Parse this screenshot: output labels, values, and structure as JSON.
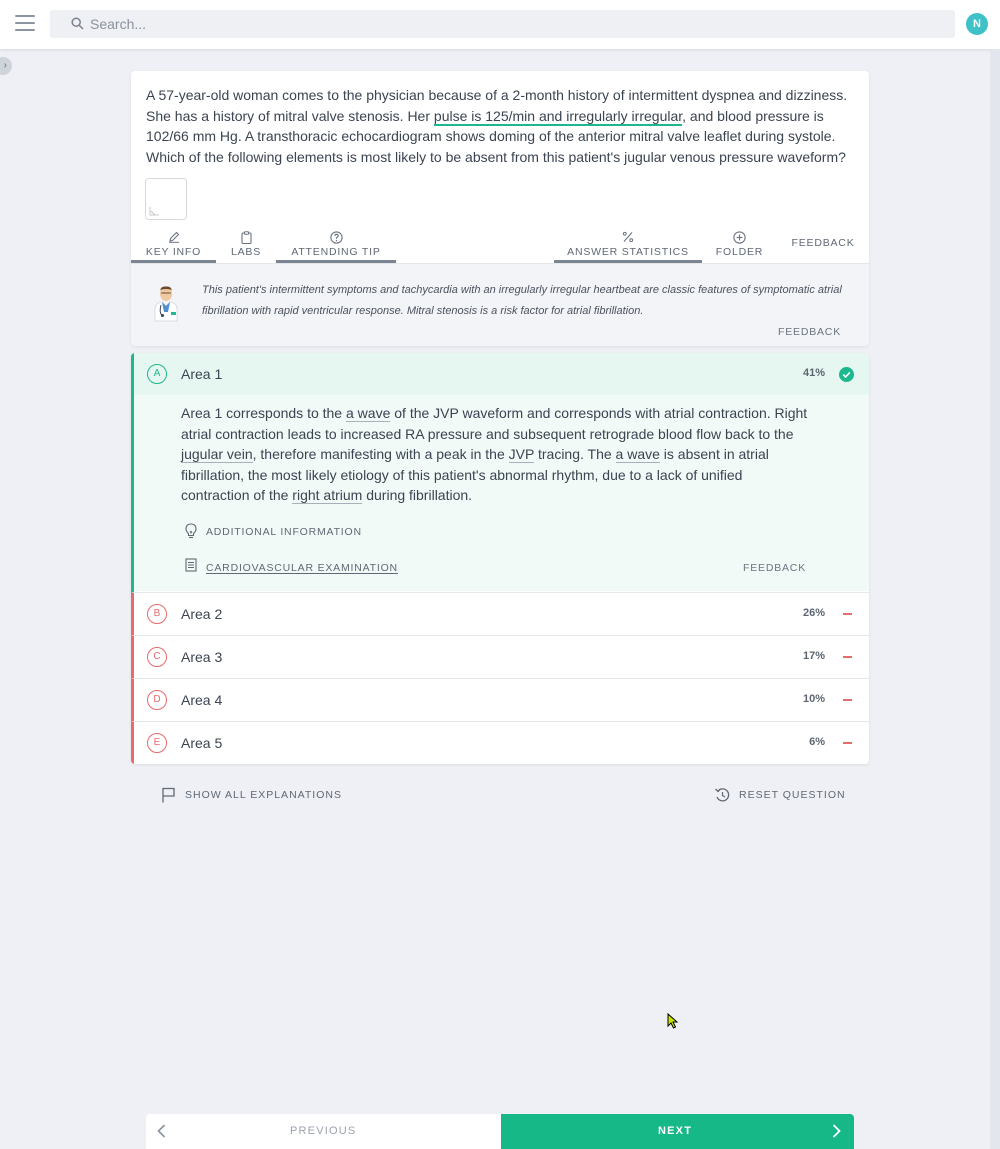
{
  "header": {
    "search_placeholder": "Search...",
    "avatar_initial": "N"
  },
  "question": {
    "stem_part1": "A 57-year-old woman comes to the physician because of a 2-month history of intermittent dyspnea and dizziness. She has a history of mitral valve stenosis. Her ",
    "stem_highlight": "pulse is 125/min and irregularly irregular",
    "stem_part2": ", and blood pressure is 102/66 mm Hg. A transthoracic echocardiogram shows doming of the anterior mitral valve leaflet during systole. Which of the following elements is most likely to be absent from this patient's jugular venous pressure waveform?"
  },
  "tabs": {
    "key_info": "KEY INFO",
    "labs": "LABS",
    "attending_tip": "ATTENDING TIP",
    "answer_statistics": "ANSWER STATISTICS",
    "folder": "FOLDER",
    "feedback": "FEEDBACK"
  },
  "tip": {
    "text": "This patient's intermittent symptoms and tachycardia with an irregularly irregular heartbeat are classic features of symptomatic atrial fibrillation with rapid ventricular response. Mitral stenosis is a risk factor for atrial fibrillation.",
    "feedback": "FEEDBACK"
  },
  "answers": [
    {
      "letter": "A",
      "label": "Area 1",
      "pct": "41%"
    },
    {
      "letter": "B",
      "label": "Area 2",
      "pct": "26%"
    },
    {
      "letter": "C",
      "label": "Area 3",
      "pct": "17%"
    },
    {
      "letter": "D",
      "label": "Area 4",
      "pct": "10%"
    },
    {
      "letter": "E",
      "label": "Area 5",
      "pct": "6%"
    }
  ],
  "explanation": {
    "t1": "Area 1 corresponds to the ",
    "u1": "a wave",
    "t2": " of the JVP waveform and corresponds with atrial contraction. Right atrial contraction leads to increased RA pressure and subsequent retrograde blood flow back to the ",
    "u2": "jugular vein",
    "t3": ", therefore manifesting with a peak in the ",
    "u3": "JVP",
    "t4": " tracing. The ",
    "u4": "a wave",
    "t5": " is absent in atrial fibrillation, the most likely etiology of this patient's abnormal rhythm, due to a lack of unified contraction of the ",
    "u5": "right atrium",
    "t6": " during fibrillation.",
    "additional": "ADDITIONAL INFORMATION",
    "cv_link": "CARDIOVASCULAR EXAMINATION",
    "feedback": "FEEDBACK"
  },
  "actions": {
    "show_all": "SHOW ALL EXPLANATIONS",
    "reset": "RESET QUESTION"
  },
  "nav": {
    "previous": "PREVIOUS",
    "next": "NEXT"
  },
  "colors": {
    "correct": "#1db88e",
    "incorrect": "#e86a6a",
    "next_button": "#15b886",
    "avatar": "#3ec2c8"
  },
  "icons": [
    "menu-icon",
    "search-icon",
    "pencil-icon",
    "clipboard-icon",
    "question-circle-icon",
    "percent-icon",
    "plus-circle-icon",
    "doctor-icon",
    "check-circle-icon",
    "lightbulb-icon",
    "document-icon",
    "flag-icon",
    "reset-icon",
    "chevron-left-icon",
    "chevron-right-icon"
  ]
}
